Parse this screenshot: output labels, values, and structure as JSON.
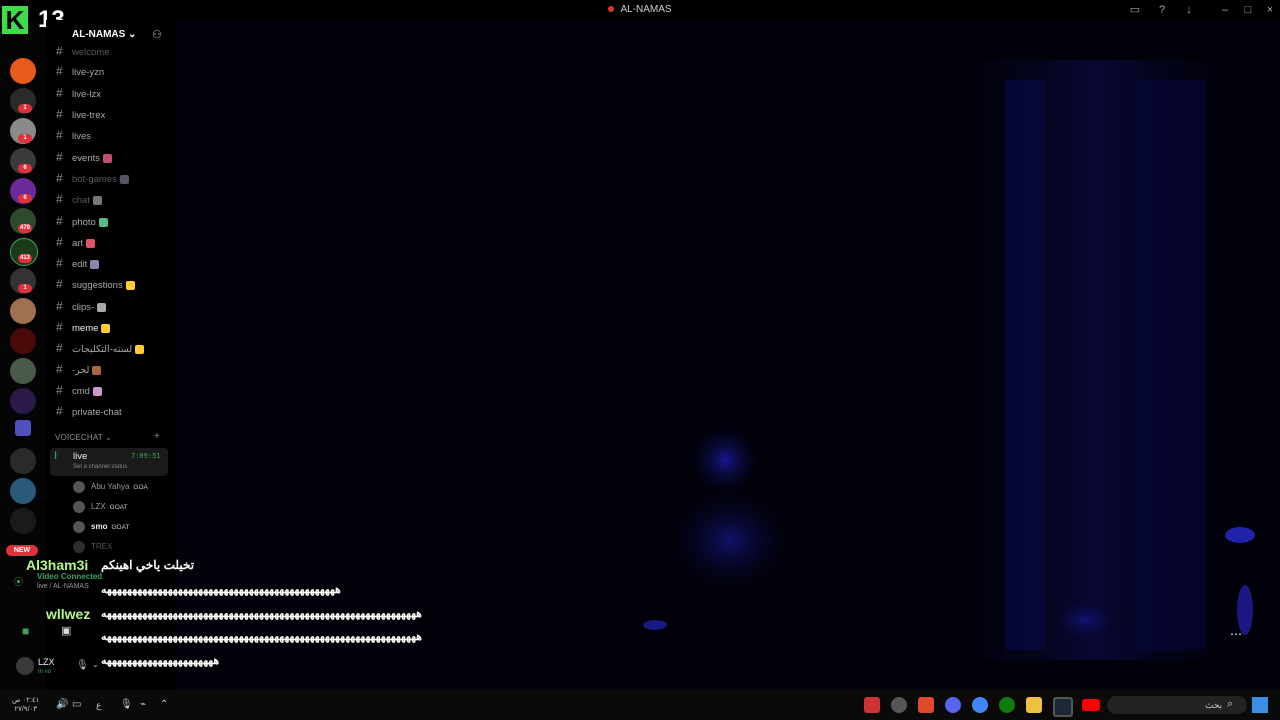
{
  "brand": {
    "letter": "K",
    "number": "13"
  },
  "window": {
    "title": "AL-NAMAS"
  },
  "server": {
    "name": "AL-NAMAS"
  },
  "channels": [
    {
      "name": "welcome",
      "style": "muted"
    },
    {
      "name": "live-yzn",
      "style": "normal"
    },
    {
      "name": "live-lzx",
      "style": "normal"
    },
    {
      "name": "live-trex",
      "style": "normal"
    },
    {
      "name": "lives",
      "style": "normal"
    },
    {
      "name": "events",
      "style": "normal",
      "emoji": "#c05070"
    },
    {
      "name": "bot-games",
      "style": "muted",
      "emoji": "#556"
    },
    {
      "name": "chat",
      "style": "muted",
      "emoji": "#777"
    },
    {
      "name": "photo",
      "style": "normal",
      "emoji": "#5b8"
    },
    {
      "name": "art",
      "style": "normal",
      "emoji": "#d56"
    },
    {
      "name": "edit",
      "style": "normal",
      "emoji": "#88a"
    },
    {
      "name": "suggestions",
      "style": "normal",
      "emoji": "#fc3"
    },
    {
      "name": "clips-",
      "style": "normal",
      "emoji": "#aaa"
    },
    {
      "name": "meme",
      "style": "bright",
      "emoji": "#fc3"
    },
    {
      "name": "لسته-التكليجات",
      "style": "normal",
      "emoji": "#fc3"
    },
    {
      "name": "-لجر",
      "style": "normal",
      "emoji": "#a64"
    },
    {
      "name": "cmd",
      "style": "normal",
      "emoji": "#c9c"
    },
    {
      "name": "private-chat",
      "style": "normal"
    }
  ],
  "voice": {
    "header": "VOICECHAT",
    "channel": "live",
    "timer": "7:09:51",
    "status": "Set a channel status",
    "members": [
      {
        "name": "Abu Yahya",
        "tag": "GOA"
      },
      {
        "name": "LZX",
        "tag": "GOAT"
      },
      {
        "name": "smo",
        "tag": "GOAT"
      },
      {
        "name": "TREX",
        "tag": ""
      }
    ]
  },
  "rail_badges": [
    "1",
    "1",
    "6",
    "6",
    "478",
    "413",
    "1"
  ],
  "rail_new": "NEW",
  "voice_panel": {
    "status": "Video Connected",
    "location": "live / AL-NAMAS"
  },
  "user_panel": {
    "name": "LZX",
    "status": "In vo"
  },
  "overlay": {
    "user1": "Al3ham3i",
    "msg1": "تخيلت ياخي اهينكم",
    "msg2": "ههههههههههههههههههههههههههههههههههههههههههههههه",
    "user2": "wllwez",
    "msg3": "ههههههههههههههههههههههههههههههههههههههههههههههههههههههههههههههه",
    "msg4": "ههههههههههههههههههههههههههههههههههههههههههههههههههههههههههههههه",
    "msg5": "ههههههههههههههههههههههه"
  },
  "more_label": "⋯",
  "taskbar": {
    "clock_time": "٠٢:٤١ ص",
    "clock_date": "٢٧/٩/٠٣",
    "lang": "ع",
    "search": "بحث"
  },
  "colors": {
    "brand_green": "#3ddc4a",
    "badge_red": "#e0303a",
    "connected_green": "#3ba55d",
    "video_blue": "#1a1aa0"
  }
}
